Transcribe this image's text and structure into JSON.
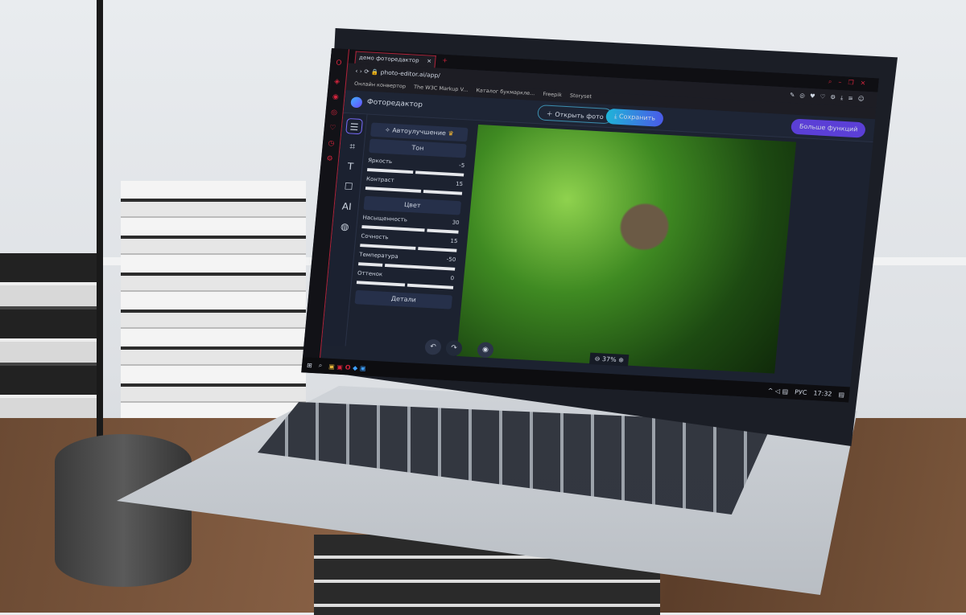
{
  "browser": {
    "tab_title": "демо фоторедактор",
    "url": "photo-editor.ai/app/",
    "bookmarks": [
      "Онлайн конвертор",
      "The W3C Markup V...",
      "Каталог букмарклe...",
      "Freepik",
      "Storyset"
    ]
  },
  "app": {
    "name": "Фоторедактор",
    "open_photo": "Открыть фото",
    "save": "Сохранить",
    "more": "Больше функций",
    "accent": "#5b3fd6",
    "save_color": "#1fb4d8"
  },
  "panel": {
    "auto": "Автоулучшение",
    "tone": "Тон",
    "color": "Цвет",
    "details": "Детали",
    "sliders": [
      {
        "label": "Яркость",
        "value": "-5",
        "group": "tone"
      },
      {
        "label": "Контраст",
        "value": "15",
        "group": "tone"
      },
      {
        "label": "Насыщенность",
        "value": "30",
        "group": "color"
      },
      {
        "label": "Сочность",
        "value": "15",
        "group": "color"
      },
      {
        "label": "Температура",
        "value": "-50",
        "group": "color"
      },
      {
        "label": "Оттенок",
        "value": "0",
        "group": "color"
      }
    ]
  },
  "zoom": {
    "level": "37%"
  },
  "taskbar": {
    "lang": "РУС",
    "time": "17:32"
  }
}
